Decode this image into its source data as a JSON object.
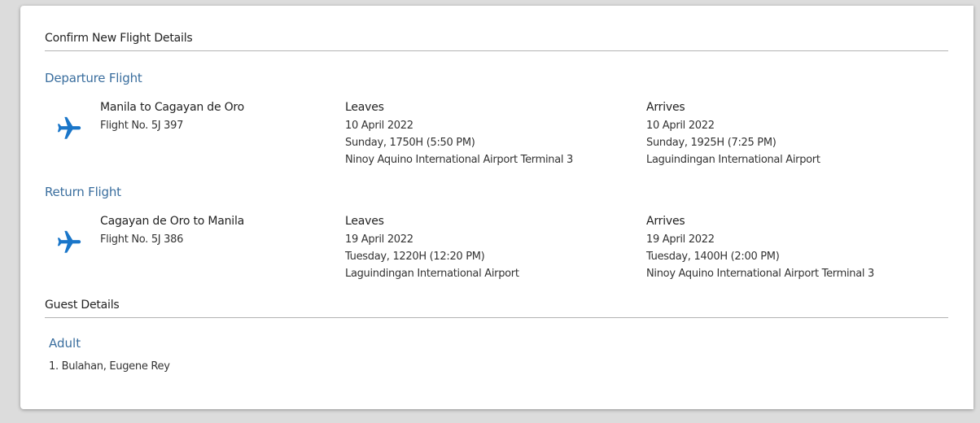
{
  "header": {
    "title": "Confirm New Flight Details"
  },
  "departure": {
    "section_label": "Departure Flight",
    "route": "Manila to Cagayan de Oro",
    "flight_no": "Flight No. 5J 397",
    "leaves": {
      "label": "Leaves",
      "date": "10 April 2022",
      "time": "Sunday, 1750H (5:50 PM)",
      "airport": "Ninoy Aquino International Airport Terminal 3"
    },
    "arrives": {
      "label": "Arrives",
      "date": "10 April 2022",
      "time": "Sunday, 1925H (7:25 PM)",
      "airport": "Laguindingan International Airport"
    }
  },
  "return": {
    "section_label": "Return Flight",
    "route": "Cagayan de Oro to Manila",
    "flight_no": "Flight No. 5J 386",
    "leaves": {
      "label": "Leaves",
      "date": "19 April 2022",
      "time": "Tuesday, 1220H (12:20 PM)",
      "airport": "Laguindingan International Airport"
    },
    "arrives": {
      "label": "Arrives",
      "date": "19 April 2022",
      "time": "Tuesday, 1400H (2:00 PM)",
      "airport": "Ninoy Aquino International Airport Terminal 3"
    }
  },
  "guests": {
    "title": "Guest Details",
    "type_label": "Adult",
    "list": [
      "1. Bulahan, Eugene Rey"
    ]
  },
  "icons": {
    "flight": "airplane-icon"
  },
  "colors": {
    "accent": "#3a6e9e",
    "plane": "#1a76c9",
    "divider": "#b3b3b3",
    "background": "#dcdcdc"
  }
}
